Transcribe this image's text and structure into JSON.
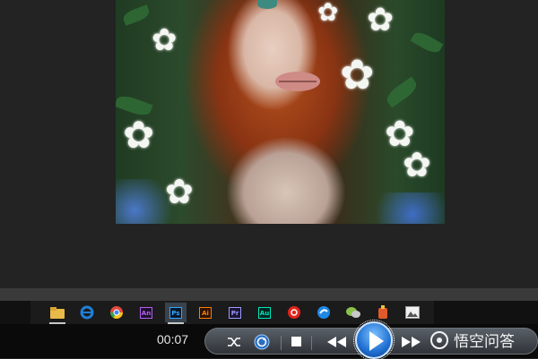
{
  "player": {
    "time": "00:07",
    "buttons": {
      "shuffle": "shuffle-icon",
      "repeat": "repeat-icon",
      "stop": "stop-icon",
      "previous": "rewind-icon",
      "play": "play-icon",
      "next": "fast-forward-icon"
    }
  },
  "taskbar": {
    "apps": [
      {
        "name": "file-explorer-icon",
        "color": "#e9b949"
      },
      {
        "name": "ie-browser-icon",
        "color": "#1e7fd8"
      },
      {
        "name": "chrome-icon",
        "color": "#e04b3c"
      },
      {
        "name": "adobe-animate-icon",
        "label": "An",
        "color": "#b45ff0"
      },
      {
        "name": "adobe-photoshop-icon",
        "label": "Ps",
        "color": "#31a8ff"
      },
      {
        "name": "adobe-illustrator-icon",
        "label": "Ai",
        "color": "#ff7c00"
      },
      {
        "name": "adobe-premiere-icon",
        "label": "Pr",
        "color": "#9999ff"
      },
      {
        "name": "adobe-audition-icon",
        "label": "Au",
        "color": "#00e4bb"
      },
      {
        "name": "netease-music-icon",
        "color": "#e2231a"
      },
      {
        "name": "sogou-icon",
        "color": "#1e88e5"
      },
      {
        "name": "wechat-icon",
        "color": "#8bc34a"
      },
      {
        "name": "app-icon",
        "color": "#e05a2b"
      },
      {
        "name": "image-viewer-icon",
        "color": "#dcdcdc"
      }
    ]
  },
  "watermark": {
    "text": "悟空问答"
  }
}
